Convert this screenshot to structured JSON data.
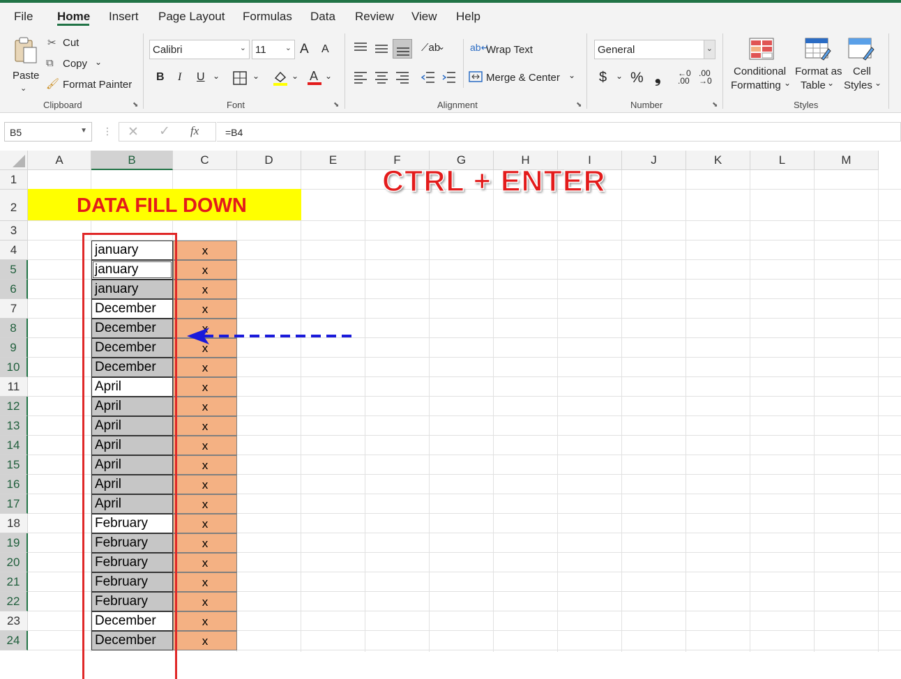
{
  "menu": {
    "items": [
      "File",
      "Home",
      "Insert",
      "Page Layout",
      "Formulas",
      "Data",
      "Review",
      "View",
      "Help"
    ],
    "active": "Home"
  },
  "ribbon": {
    "clipboard": {
      "paste": "Paste",
      "cut": "Cut",
      "copy": "Copy",
      "format_painter": "Format Painter",
      "label": "Clipboard"
    },
    "font": {
      "name": "Calibri",
      "size": "11",
      "bold": "B",
      "italic": "I",
      "underline": "U",
      "grow": "A",
      "shrink": "A",
      "label": "Font",
      "fill_color": "#ffff00",
      "font_color": "#e31b1b"
    },
    "alignment": {
      "wrap_text": "Wrap Text",
      "merge_center": "Merge & Center",
      "label": "Alignment"
    },
    "number": {
      "format": "General",
      "currency": "$",
      "percent": "%",
      "comma": "❟",
      "label": "Number"
    },
    "styles": {
      "conditional_1": "Conditional",
      "conditional_2": "Formatting",
      "format_table_1": "Format as",
      "format_table_2": "Table",
      "cell_styles_1": "Cell",
      "cell_styles_2": "Styles",
      "label": "Styles"
    }
  },
  "formula_bar": {
    "name_box": "B5",
    "formula": "=B4"
  },
  "sheet": {
    "columns": [
      "A",
      "B",
      "C",
      "D",
      "E",
      "F",
      "G",
      "H",
      "I",
      "J",
      "K",
      "L",
      "M"
    ],
    "selected_column": "B",
    "rows": [
      "1",
      "2",
      "3",
      "4",
      "5",
      "6",
      "7",
      "8",
      "9",
      "10",
      "11",
      "12",
      "13",
      "14",
      "15",
      "16",
      "17",
      "18",
      "19",
      "20",
      "21",
      "22",
      "23",
      "24"
    ],
    "title": "DATA FILL DOWN",
    "title_color": "#e31b1b",
    "title_fill": "#ffff00",
    "column_c_fill": "#f4b183",
    "data": [
      {
        "row": "4",
        "b": "january",
        "c": "x",
        "selected": false
      },
      {
        "row": "5",
        "b": "january",
        "c": "x",
        "selected": true,
        "active": true
      },
      {
        "row": "6",
        "b": "january",
        "c": "x",
        "selected": true
      },
      {
        "row": "7",
        "b": "December",
        "c": "x",
        "selected": false
      },
      {
        "row": "8",
        "b": "December",
        "c": "x",
        "selected": true
      },
      {
        "row": "9",
        "b": "December",
        "c": "x",
        "selected": true
      },
      {
        "row": "10",
        "b": "December",
        "c": "x",
        "selected": true
      },
      {
        "row": "11",
        "b": "April",
        "c": "x",
        "selected": false
      },
      {
        "row": "12",
        "b": "April",
        "c": "x",
        "selected": true
      },
      {
        "row": "13",
        "b": "April",
        "c": "x",
        "selected": true
      },
      {
        "row": "14",
        "b": "April",
        "c": "x",
        "selected": true
      },
      {
        "row": "15",
        "b": "April",
        "c": "x",
        "selected": true
      },
      {
        "row": "16",
        "b": "April",
        "c": "x",
        "selected": true
      },
      {
        "row": "17",
        "b": "April",
        "c": "x",
        "selected": true
      },
      {
        "row": "18",
        "b": "February",
        "c": "x",
        "selected": false
      },
      {
        "row": "19",
        "b": "February",
        "c": "x",
        "selected": true
      },
      {
        "row": "20",
        "b": "February",
        "c": "x",
        "selected": true
      },
      {
        "row": "21",
        "b": "February",
        "c": "x",
        "selected": true
      },
      {
        "row": "22",
        "b": "February",
        "c": "x",
        "selected": true
      },
      {
        "row": "23",
        "b": "December",
        "c": "x",
        "selected": false
      },
      {
        "row": "24",
        "b": "December",
        "c": "x",
        "selected": true
      }
    ],
    "selected_rows": [
      "5",
      "6",
      "8",
      "9",
      "10",
      "12",
      "13",
      "14",
      "15",
      "16",
      "17",
      "19",
      "20",
      "21",
      "22",
      "24"
    ]
  },
  "annotation": {
    "callout": "CTRL + ENTER",
    "arrow_color": "#1a1adb",
    "frame_color": "#e02828"
  }
}
